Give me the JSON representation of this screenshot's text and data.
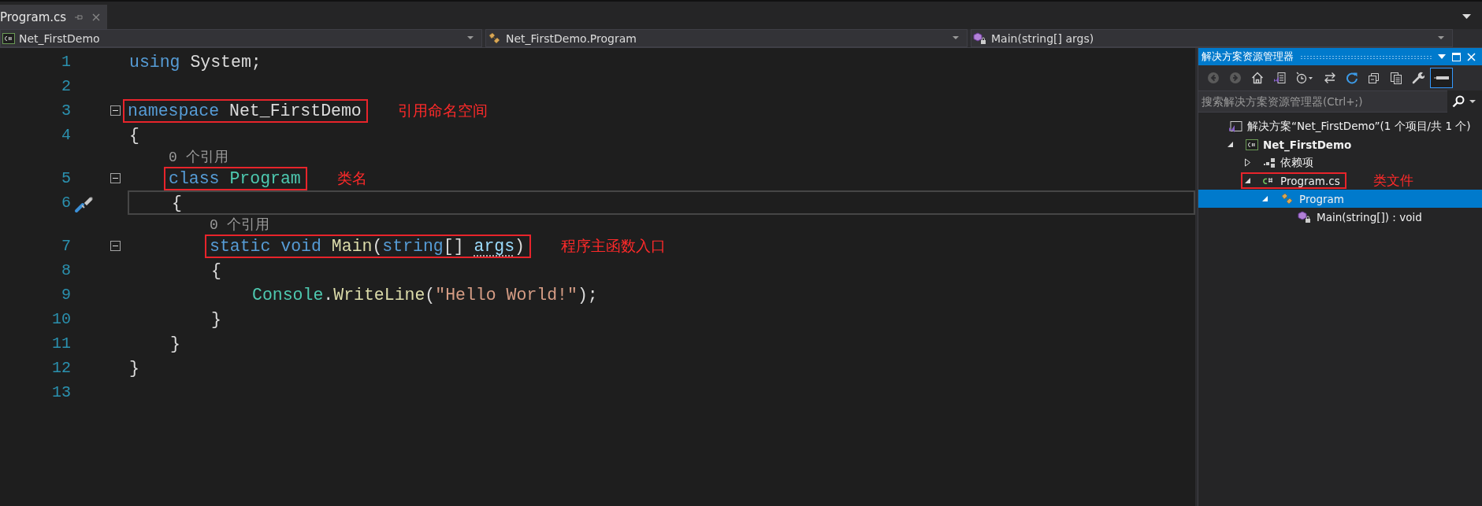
{
  "tabs": [
    {
      "label": "Program.cs",
      "selected": true
    }
  ],
  "nav_bar": [
    {
      "kind": "project",
      "label": "Net_FirstDemo"
    },
    {
      "kind": "class",
      "label": "Net_FirstDemo.Program"
    },
    {
      "kind": "method",
      "label": "Main(string[] args)"
    }
  ],
  "code_lines": [
    {
      "kind": "code",
      "number": "1",
      "tokens": [
        {
          "kind": "keyword",
          "text": "using"
        },
        {
          "kind": "plain",
          "text": " System;"
        }
      ]
    },
    {
      "kind": "code",
      "number": "2"
    },
    {
      "kind": "code",
      "number": "3",
      "expanded": true,
      "highlight": true,
      "note": "引用命名空间",
      "tokens": [
        {
          "kind": "keyword",
          "text": "namespace"
        },
        {
          "kind": "plain",
          "text": " Net_FirstDemo"
        }
      ]
    },
    {
      "kind": "code",
      "number": "4",
      "tokens": [
        {
          "kind": "plain",
          "text": "{"
        }
      ],
      "children": [
        {
          "kind": "codelens",
          "text": "0 个引用"
        },
        {
          "kind": "code",
          "number": "5",
          "expanded": true,
          "highlight": true,
          "note": "类名",
          "tokens": [
            {
              "kind": "keyword",
              "text": "class "
            },
            {
              "kind": "type",
              "text": "Program"
            }
          ]
        },
        {
          "kind": "code",
          "number": "6",
          "current": true,
          "tool": true,
          "tokens": [
            {
              "kind": "plain",
              "text": "{"
            }
          ],
          "children": [
            {
              "kind": "codelens",
              "text": "0 个引用"
            },
            {
              "kind": "code",
              "number": "7",
              "expanded": true,
              "highlight": true,
              "note": "程序主函数入口",
              "tokens": [
                {
                  "kind": "keyword",
                  "text": "static void "
                },
                {
                  "kind": "method",
                  "text": "Main"
                },
                {
                  "kind": "plain",
                  "text": "("
                },
                {
                  "kind": "keyword",
                  "text": "string"
                },
                {
                  "kind": "plain",
                  "text": "[] "
                },
                {
                  "kind": "param",
                  "text": "args"
                },
                {
                  "kind": "plain",
                  "text": ")"
                }
              ]
            },
            {
              "kind": "code",
              "number": "8",
              "tokens": [
                {
                  "kind": "plain",
                  "text": "{"
                }
              ],
              "children": [
                {
                  "kind": "code",
                  "number": "9",
                  "tokens": [
                    {
                      "kind": "type",
                      "text": "Console"
                    },
                    {
                      "kind": "plain",
                      "text": "."
                    },
                    {
                      "kind": "method",
                      "text": "WriteLine"
                    },
                    {
                      "kind": "plain",
                      "text": "("
                    },
                    {
                      "kind": "string",
                      "text": "\"Hello World!\""
                    },
                    {
                      "kind": "plain",
                      "text": ");"
                    }
                  ]
                }
              ]
            },
            {
              "kind": "code",
              "number": "10",
              "tokens": [
                {
                  "kind": "plain",
                  "text": "}"
                }
              ]
            }
          ]
        },
        {
          "kind": "code",
          "number": "11",
          "tokens": [
            {
              "kind": "plain",
              "text": "}"
            }
          ]
        }
      ]
    },
    {
      "kind": "code",
      "number": "12",
      "tokens": [
        {
          "kind": "plain",
          "text": "}"
        }
      ]
    },
    {
      "kind": "code",
      "number": "13"
    }
  ],
  "solution_explorer": {
    "title": "解决方案资源管理器",
    "toolbar": [
      {
        "kind": "back",
        "disabled": true,
        "selected": false
      },
      {
        "kind": "forward",
        "disabled": true,
        "selected": false
      },
      {
        "kind": "home",
        "disabled": false,
        "selected": false
      },
      {
        "kind": "switch-view",
        "disabled": false,
        "selected": false
      },
      {
        "kind": "history",
        "disabled": false,
        "selected": false
      },
      {
        "kind": "sync",
        "disabled": false,
        "selected": false
      },
      {
        "kind": "refresh",
        "disabled": false,
        "selected": false
      },
      {
        "kind": "collapse",
        "disabled": false,
        "selected": false
      },
      {
        "kind": "show-all",
        "disabled": false,
        "selected": false
      },
      {
        "kind": "wrench",
        "disabled": false,
        "selected": false
      },
      {
        "kind": "preview",
        "disabled": false,
        "selected": true
      }
    ],
    "search": {
      "placeholder": "搜索解决方案资源管理器(Ctrl+;)"
    },
    "tree": [
      {
        "kind": "solution",
        "label": "解决方案“Net_FirstDemo”(1 个项目/共 1 个)",
        "selected": false,
        "children": [
          {
            "kind": "project",
            "label": "Net_FirstDemo",
            "expanded": true,
            "selected": false,
            "children": [
              {
                "kind": "dependencies",
                "label": "依赖项",
                "expanded": false,
                "selected": false
              },
              {
                "kind": "csfile",
                "label": "Program.cs",
                "expanded": true,
                "selected": false,
                "highlight": true,
                "note": "类文件",
                "children": [
                  {
                    "kind": "class",
                    "label": "Program",
                    "expanded": true,
                    "selected": true,
                    "children": [
                      {
                        "kind": "method",
                        "label": "Main(string[]) : void",
                        "selected": false
                      }
                    ]
                  }
                ]
              }
            ]
          }
        ]
      }
    ]
  }
}
